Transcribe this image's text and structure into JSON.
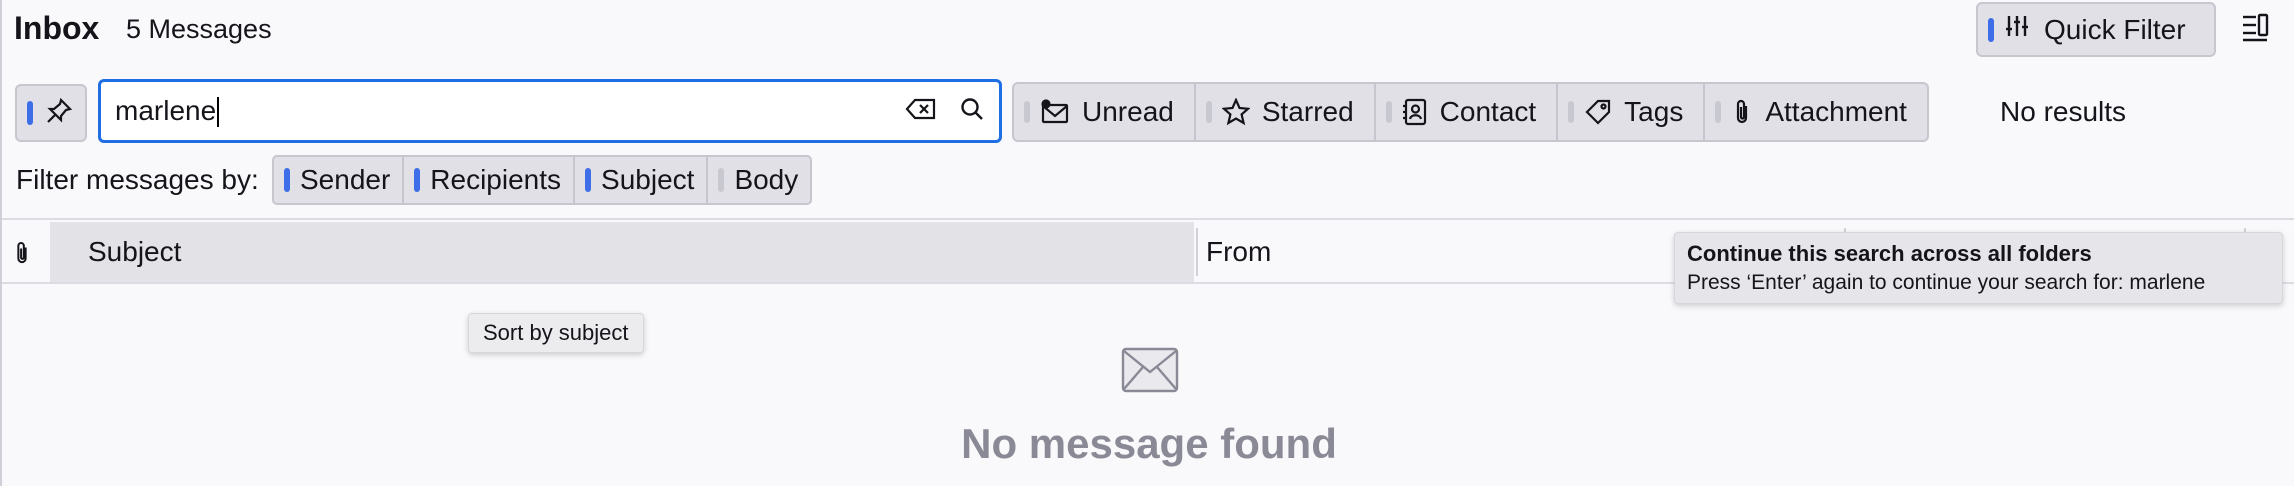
{
  "header": {
    "title": "Inbox",
    "count": "5 Messages",
    "quick_filter_label": "Quick Filter"
  },
  "search": {
    "value": "marlene"
  },
  "filters": {
    "items": [
      {
        "label": "Unread",
        "icon": "unread-icon"
      },
      {
        "label": "Starred",
        "icon": "star-icon"
      },
      {
        "label": "Contact",
        "icon": "contact-icon"
      },
      {
        "label": "Tags",
        "icon": "tag-icon"
      },
      {
        "label": "Attachment",
        "icon": "paperclip-icon"
      }
    ],
    "status": "No results"
  },
  "filter_by": {
    "label": "Filter messages by:",
    "chips": [
      {
        "label": "Sender",
        "active": true
      },
      {
        "label": "Recipients",
        "active": true
      },
      {
        "label": "Subject",
        "active": true
      },
      {
        "label": "Body",
        "active": false
      }
    ]
  },
  "table": {
    "col_subject": "Subject",
    "col_from": "From"
  },
  "tooltips": {
    "sort": "Sort by subject",
    "continue_title": "Continue this search across all folders",
    "continue_body": "Press ‘Enter’ again to continue your search for: marlene"
  },
  "empty": {
    "text": "No message found"
  },
  "colors": {
    "accent": "#3d6ee8",
    "focus": "#1f6ee3",
    "muted": "#8a8a96"
  }
}
